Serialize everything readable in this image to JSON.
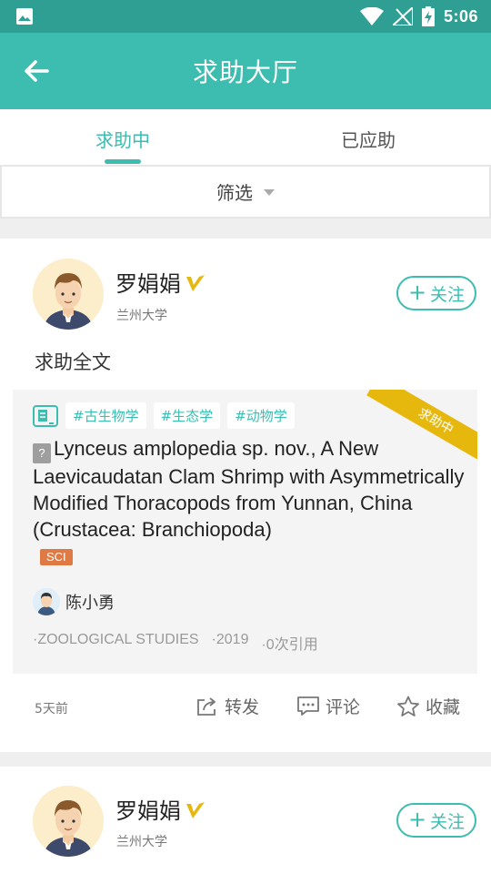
{
  "app": {
    "title": "求助大厅",
    "back_icon": "arrow-left-icon"
  },
  "status_bar": {
    "time": "5:06",
    "icons": [
      "gallery-icon",
      "wifi-icon",
      "no-signal-icon",
      "battery-charging-icon"
    ]
  },
  "tabs": [
    {
      "label": "求助中",
      "active": true
    },
    {
      "label": "已应助",
      "active": false
    }
  ],
  "filter": {
    "label": "筛选"
  },
  "colors": {
    "accent": "#3dbdb0",
    "ribbon": "#e6b80e",
    "sci": "#e07a45"
  },
  "posts": [
    {
      "user": {
        "name": "罗娟娟",
        "school": "兰州大学",
        "verified_icon": "v-badge-icon"
      },
      "follow_label": "关注",
      "request_type": "求助全文",
      "status_ribbon": "求助中",
      "tags": [
        "#古生物学",
        "#生态学",
        "#动物学"
      ],
      "paper_title": "Lynceus amplopedia sp. nov., A New Laevicaudatan Clam Shrimp with Asymmetrically Modified Thoracopods from Yunnan, China (Crustacea: Branchiopoda)",
      "badge": "SCI",
      "author": "陈小勇",
      "journal": "·ZOOLOGICAL STUDIES",
      "year": "·2019",
      "citations": "·0次引用",
      "time_ago": "5天前",
      "actions": {
        "share": "转发",
        "comment": "评论",
        "favorite": "收藏"
      }
    },
    {
      "user": {
        "name": "罗娟娟",
        "school": "兰州大学",
        "verified_icon": "v-badge-icon"
      },
      "follow_label": "关注"
    }
  ]
}
